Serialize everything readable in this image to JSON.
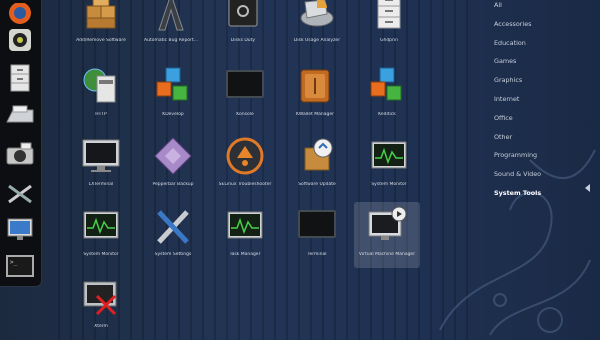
{
  "dash": {
    "items": [
      {
        "name": "firefox-icon"
      },
      {
        "name": "rhythmbox-icon"
      },
      {
        "name": "file-cabinet-icon"
      },
      {
        "name": "scanner-icon"
      },
      {
        "name": "camera-icon"
      },
      {
        "name": "settings-tools-icon"
      },
      {
        "name": "display-icon"
      },
      {
        "name": "terminal-icon"
      }
    ]
  },
  "apps": [
    {
      "label": "Add/Remove Software",
      "icon": "boxes-icon"
    },
    {
      "label": "Automatic Bug Report...",
      "icon": "bug-report-icon"
    },
    {
      "label": "Disks Duty",
      "icon": "safe-icon"
    },
    {
      "label": "Disk Usage Analyzer",
      "icon": "disk-usage-icon"
    },
    {
      "label": "Ghdprin",
      "icon": "file-cabinet-icon"
    },
    {
      "label": "HTTP",
      "icon": "network-icon"
    },
    {
      "label": "KDevelop",
      "icon": "cubes-icon"
    },
    {
      "label": "Konsole",
      "icon": "terminal-icon"
    },
    {
      "label": "KWallet Manager",
      "icon": "wallet-icon"
    },
    {
      "label": "Keditick",
      "icon": "cubes-icon"
    },
    {
      "label": "LXTerminal",
      "icon": "monitor-icon"
    },
    {
      "label": "Pepperbar Backup",
      "icon": "backup-icon"
    },
    {
      "label": "SELinux Troubleshooter",
      "icon": "selinux-icon"
    },
    {
      "label": "Software Update",
      "icon": "software-update-icon"
    },
    {
      "label": "System Monitor",
      "icon": "system-monitor-icon"
    },
    {
      "label": "System Monitor",
      "icon": "system-monitor-icon"
    },
    {
      "label": "System Settings",
      "icon": "tools-icon"
    },
    {
      "label": "Task Manager",
      "icon": "system-monitor-icon"
    },
    {
      "label": "Terminal",
      "icon": "terminal-icon"
    },
    {
      "label": "Virtual Machine Manager",
      "icon": "virt-manager-icon"
    },
    {
      "label": "Xterm",
      "icon": "xterm-icon"
    }
  ],
  "categories": [
    "All",
    "Accessories",
    "Education",
    "Games",
    "Graphics",
    "Internet",
    "Office",
    "Other",
    "Programming",
    "Sound & Video",
    "System Tools"
  ],
  "active_category": "System Tools"
}
